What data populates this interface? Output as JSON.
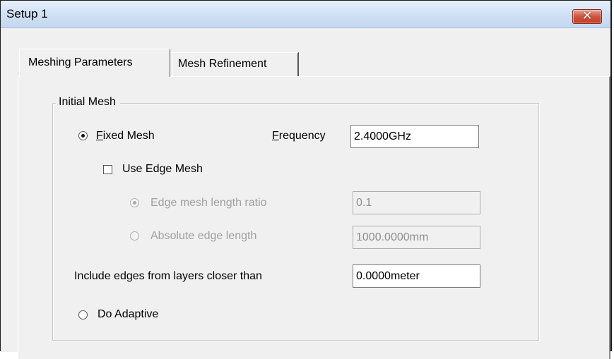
{
  "window": {
    "title": "Setup 1",
    "close_glyph": "✕"
  },
  "tabs": [
    {
      "label": "Meshing Parameters",
      "active": true
    },
    {
      "label": "Mesh Refinement",
      "active": false
    }
  ],
  "initial_mesh": {
    "legend": "Initial Mesh",
    "fixed_mesh": {
      "label_ul": "F",
      "label_rest": "ixed Mesh",
      "selected": true
    },
    "frequency": {
      "label_ul": "F",
      "label_rest": "requency",
      "value": "2.4000GHz"
    },
    "use_edge_mesh": {
      "label": "Use Edge Mesh",
      "checked": false
    },
    "edge_ratio": {
      "label": "Edge mesh length ratio",
      "value": "0.1",
      "selected": true,
      "enabled": false
    },
    "absolute_edge": {
      "label": "Absolute edge length",
      "value": "1000.0000mm",
      "selected": false,
      "enabled": false
    },
    "include_edges": {
      "label": "Include edges from layers closer than",
      "value": "0.0000meter"
    },
    "do_adaptive": {
      "label": "Do Adaptive",
      "selected": false
    }
  },
  "icons": {
    "close": "close-icon",
    "radio": "radio-button",
    "checkbox": "checkbox"
  },
  "colors": {
    "titlebar": "#cfe0f4",
    "close": "#c94a33",
    "disabled_text": "#a0a0a0"
  }
}
